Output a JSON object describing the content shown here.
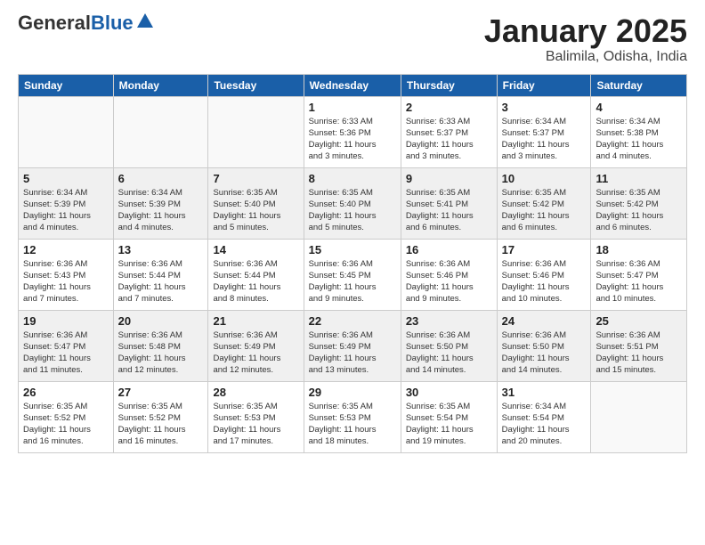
{
  "header": {
    "logo_general": "General",
    "logo_blue": "Blue",
    "month": "January 2025",
    "location": "Balimila, Odisha, India"
  },
  "weekdays": [
    "Sunday",
    "Monday",
    "Tuesday",
    "Wednesday",
    "Thursday",
    "Friday",
    "Saturday"
  ],
  "weeks": [
    {
      "days": [
        {
          "num": "",
          "info": ""
        },
        {
          "num": "",
          "info": ""
        },
        {
          "num": "",
          "info": ""
        },
        {
          "num": "1",
          "info": "Sunrise: 6:33 AM\nSunset: 5:36 PM\nDaylight: 11 hours\nand 3 minutes."
        },
        {
          "num": "2",
          "info": "Sunrise: 6:33 AM\nSunset: 5:37 PM\nDaylight: 11 hours\nand 3 minutes."
        },
        {
          "num": "3",
          "info": "Sunrise: 6:34 AM\nSunset: 5:37 PM\nDaylight: 11 hours\nand 3 minutes."
        },
        {
          "num": "4",
          "info": "Sunrise: 6:34 AM\nSunset: 5:38 PM\nDaylight: 11 hours\nand 4 minutes."
        }
      ]
    },
    {
      "days": [
        {
          "num": "5",
          "info": "Sunrise: 6:34 AM\nSunset: 5:39 PM\nDaylight: 11 hours\nand 4 minutes."
        },
        {
          "num": "6",
          "info": "Sunrise: 6:34 AM\nSunset: 5:39 PM\nDaylight: 11 hours\nand 4 minutes."
        },
        {
          "num": "7",
          "info": "Sunrise: 6:35 AM\nSunset: 5:40 PM\nDaylight: 11 hours\nand 5 minutes."
        },
        {
          "num": "8",
          "info": "Sunrise: 6:35 AM\nSunset: 5:40 PM\nDaylight: 11 hours\nand 5 minutes."
        },
        {
          "num": "9",
          "info": "Sunrise: 6:35 AM\nSunset: 5:41 PM\nDaylight: 11 hours\nand 6 minutes."
        },
        {
          "num": "10",
          "info": "Sunrise: 6:35 AM\nSunset: 5:42 PM\nDaylight: 11 hours\nand 6 minutes."
        },
        {
          "num": "11",
          "info": "Sunrise: 6:35 AM\nSunset: 5:42 PM\nDaylight: 11 hours\nand 6 minutes."
        }
      ]
    },
    {
      "days": [
        {
          "num": "12",
          "info": "Sunrise: 6:36 AM\nSunset: 5:43 PM\nDaylight: 11 hours\nand 7 minutes."
        },
        {
          "num": "13",
          "info": "Sunrise: 6:36 AM\nSunset: 5:44 PM\nDaylight: 11 hours\nand 7 minutes."
        },
        {
          "num": "14",
          "info": "Sunrise: 6:36 AM\nSunset: 5:44 PM\nDaylight: 11 hours\nand 8 minutes."
        },
        {
          "num": "15",
          "info": "Sunrise: 6:36 AM\nSunset: 5:45 PM\nDaylight: 11 hours\nand 9 minutes."
        },
        {
          "num": "16",
          "info": "Sunrise: 6:36 AM\nSunset: 5:46 PM\nDaylight: 11 hours\nand 9 minutes."
        },
        {
          "num": "17",
          "info": "Sunrise: 6:36 AM\nSunset: 5:46 PM\nDaylight: 11 hours\nand 10 minutes."
        },
        {
          "num": "18",
          "info": "Sunrise: 6:36 AM\nSunset: 5:47 PM\nDaylight: 11 hours\nand 10 minutes."
        }
      ]
    },
    {
      "days": [
        {
          "num": "19",
          "info": "Sunrise: 6:36 AM\nSunset: 5:47 PM\nDaylight: 11 hours\nand 11 minutes."
        },
        {
          "num": "20",
          "info": "Sunrise: 6:36 AM\nSunset: 5:48 PM\nDaylight: 11 hours\nand 12 minutes."
        },
        {
          "num": "21",
          "info": "Sunrise: 6:36 AM\nSunset: 5:49 PM\nDaylight: 11 hours\nand 12 minutes."
        },
        {
          "num": "22",
          "info": "Sunrise: 6:36 AM\nSunset: 5:49 PM\nDaylight: 11 hours\nand 13 minutes."
        },
        {
          "num": "23",
          "info": "Sunrise: 6:36 AM\nSunset: 5:50 PM\nDaylight: 11 hours\nand 14 minutes."
        },
        {
          "num": "24",
          "info": "Sunrise: 6:36 AM\nSunset: 5:50 PM\nDaylight: 11 hours\nand 14 minutes."
        },
        {
          "num": "25",
          "info": "Sunrise: 6:36 AM\nSunset: 5:51 PM\nDaylight: 11 hours\nand 15 minutes."
        }
      ]
    },
    {
      "days": [
        {
          "num": "26",
          "info": "Sunrise: 6:35 AM\nSunset: 5:52 PM\nDaylight: 11 hours\nand 16 minutes."
        },
        {
          "num": "27",
          "info": "Sunrise: 6:35 AM\nSunset: 5:52 PM\nDaylight: 11 hours\nand 16 minutes."
        },
        {
          "num": "28",
          "info": "Sunrise: 6:35 AM\nSunset: 5:53 PM\nDaylight: 11 hours\nand 17 minutes."
        },
        {
          "num": "29",
          "info": "Sunrise: 6:35 AM\nSunset: 5:53 PM\nDaylight: 11 hours\nand 18 minutes."
        },
        {
          "num": "30",
          "info": "Sunrise: 6:35 AM\nSunset: 5:54 PM\nDaylight: 11 hours\nand 19 minutes."
        },
        {
          "num": "31",
          "info": "Sunrise: 6:34 AM\nSunset: 5:54 PM\nDaylight: 11 hours\nand 20 minutes."
        },
        {
          "num": "",
          "info": ""
        }
      ]
    }
  ]
}
